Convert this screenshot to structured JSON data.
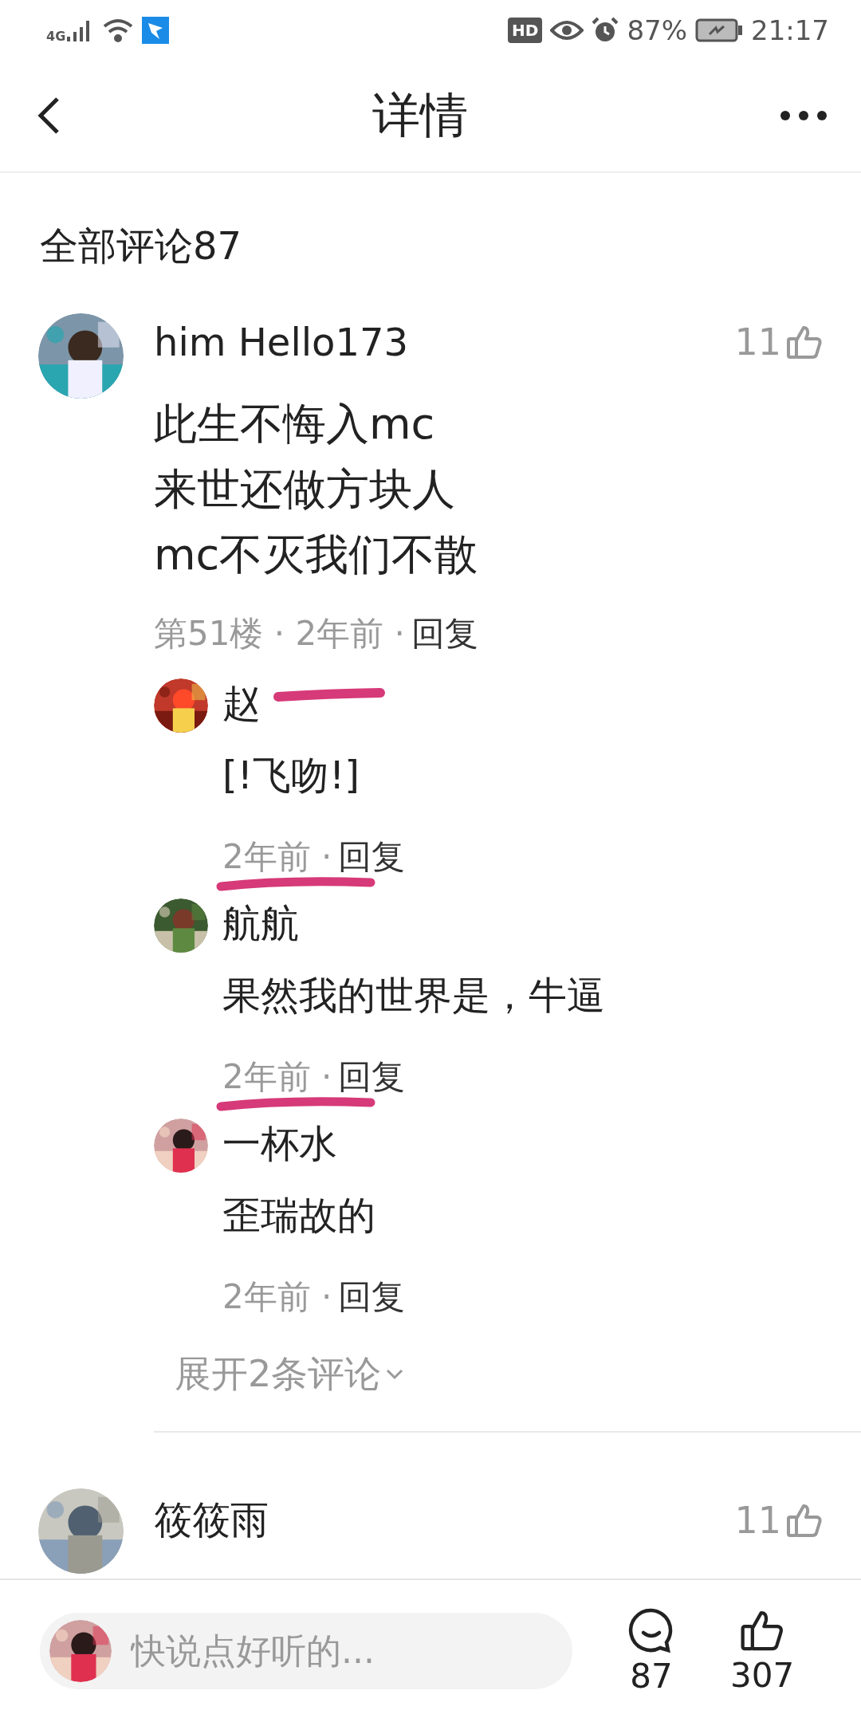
{
  "status_bar": {
    "network": "4G",
    "hd": "HD",
    "battery": "87%",
    "time": "21:17"
  },
  "header": {
    "title": "详情"
  },
  "section_title": "全部评论87",
  "comments": [
    {
      "author": "him Hello173",
      "likes": "11",
      "lines": [
        "此生不悔入mc",
        "来世还做方块人",
        "mc不灭我们不散"
      ],
      "meta": "第51楼 · 2年前 ·",
      "reply": "回复",
      "replies": [
        {
          "author": "赵",
          "redacted": true,
          "content": "[!飞吻!]",
          "meta": "2年前 ·",
          "reply": "回复",
          "underlined": true
        },
        {
          "author": "航航",
          "redacted": false,
          "content": "果然我的世界是，牛逼",
          "meta": "2年前 ·",
          "reply": "回复",
          "underlined": true
        },
        {
          "author": "一杯水",
          "redacted": false,
          "content": "歪瑞故的",
          "meta": "2年前 ·",
          "reply": "回复",
          "underlined": false
        }
      ],
      "expand": "展开2条评论"
    },
    {
      "author": "筱筱雨",
      "likes": "11"
    }
  ],
  "composer": {
    "placeholder": "快说点好听的..."
  },
  "comment_count": "87",
  "like_count": "307"
}
